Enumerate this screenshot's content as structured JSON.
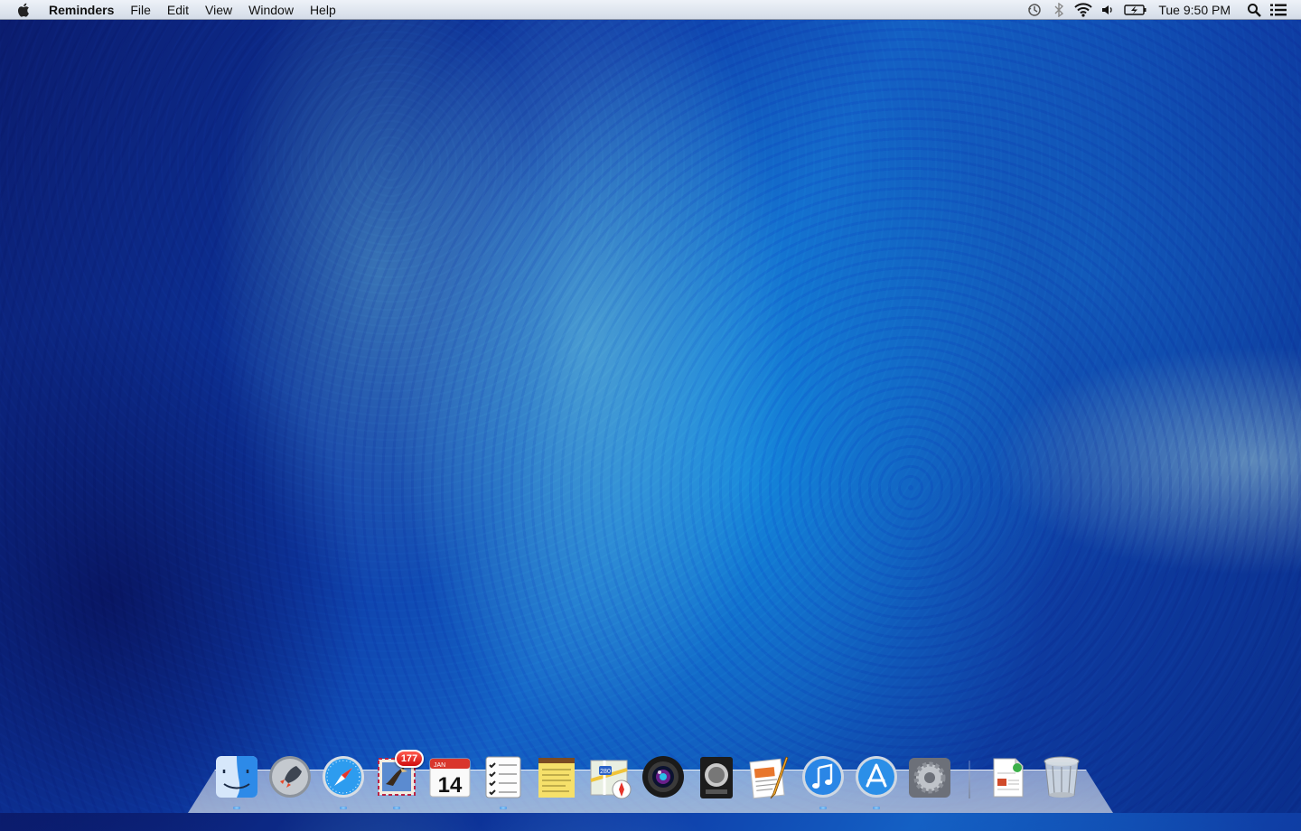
{
  "menubar": {
    "apple_icon": "apple-icon",
    "app_name": "Reminders",
    "menus": [
      "File",
      "Edit",
      "View",
      "Window",
      "Help"
    ],
    "status_icons": [
      "time-machine-icon",
      "bluetooth-icon",
      "wifi-icon",
      "volume-icon",
      "battery-charging-icon"
    ],
    "clock": "Tue 9:50 PM",
    "spotlight_icon": "spotlight-search-icon",
    "notification_icon": "notification-center-icon"
  },
  "dock": {
    "apps": [
      {
        "name": "Finder",
        "icon": "finder-icon"
      },
      {
        "name": "Launchpad",
        "icon": "launchpad-icon"
      },
      {
        "name": "Safari",
        "icon": "safari-icon"
      },
      {
        "name": "Mail",
        "icon": "mail-icon",
        "badge": "177"
      },
      {
        "name": "Calendar",
        "icon": "calendar-icon",
        "month": "JAN",
        "day": "14"
      },
      {
        "name": "Reminders",
        "icon": "reminders-icon"
      },
      {
        "name": "Notes",
        "icon": "notes-icon"
      },
      {
        "name": "Maps",
        "icon": "maps-icon",
        "route": "280"
      },
      {
        "name": "Photo Booth",
        "icon": "photo-booth-icon"
      },
      {
        "name": "Logic",
        "icon": "logic-icon"
      },
      {
        "name": "Pages",
        "icon": "pages-icon"
      },
      {
        "name": "iTunes",
        "icon": "itunes-icon"
      },
      {
        "name": "App Store",
        "icon": "app-store-icon"
      },
      {
        "name": "System Preferences",
        "icon": "system-preferences-icon"
      }
    ],
    "stacks": [
      {
        "name": "Documents",
        "icon": "document-stack-icon"
      },
      {
        "name": "Trash",
        "icon": "trash-icon"
      }
    ]
  }
}
